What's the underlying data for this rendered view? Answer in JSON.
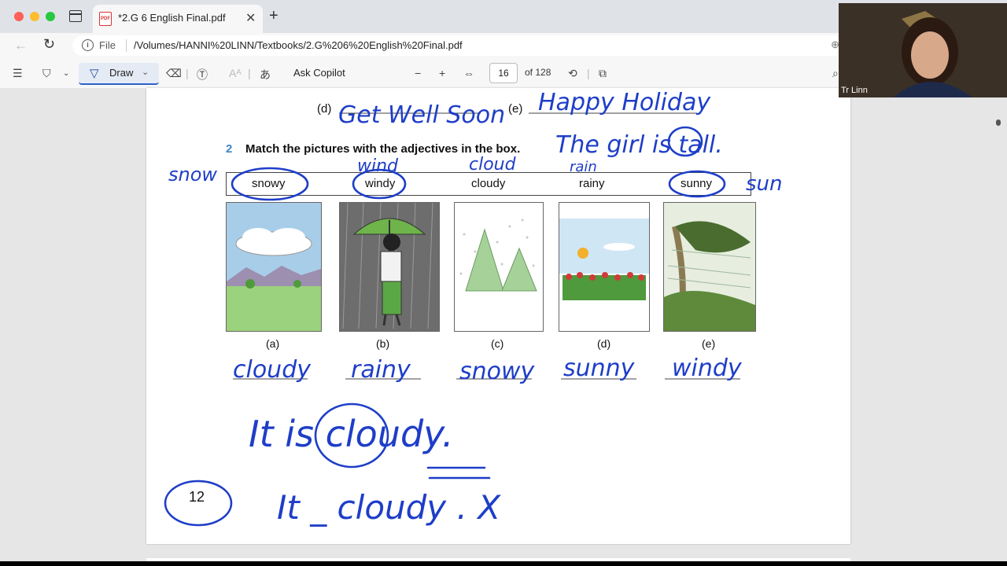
{
  "tab": {
    "title": "*2.G 6 English Final.pdf",
    "file_icon": "pdf-icon"
  },
  "address": {
    "scheme_label": "File",
    "url": "/Volumes/HANNI%20LINN/Textbooks/2.G%206%20English%20Final.pdf"
  },
  "toolbar": {
    "draw_label": "Draw",
    "ask_copilot": "Ask Copilot",
    "page_current": "16",
    "page_total": "of 128"
  },
  "page": {
    "top_items": [
      {
        "label": "(d)"
      },
      {
        "label": "(e)"
      }
    ],
    "exercise_number": "2",
    "instruction": "Match the pictures with the adjectives in the box.",
    "adjectives": [
      "snowy",
      "windy",
      "cloudy",
      "rainy",
      "sunny"
    ],
    "picture_labels": [
      "(a)",
      "(b)",
      "(c)",
      "(d)",
      "(e)"
    ],
    "handwriting": {
      "top_d": "Get Well Soon",
      "top_e": "Happy Holiday",
      "sentence1": "The girl is tall.",
      "snow": "snow",
      "wind": "wind",
      "cloud": "cloud",
      "rain": "rain",
      "sun": "sun",
      "answers": [
        "cloudy",
        "rainy",
        "snowy",
        "sunny",
        "windy"
      ],
      "example": "It is cloudy.",
      "circled_number": "12",
      "wrong_example": "It _ cloudy . X"
    }
  },
  "webcam": {
    "name": "Tr Linn"
  },
  "colors": {
    "ink": "#1e3ec8",
    "accent": "#2d62c8",
    "number_blue": "#3a86c6"
  }
}
